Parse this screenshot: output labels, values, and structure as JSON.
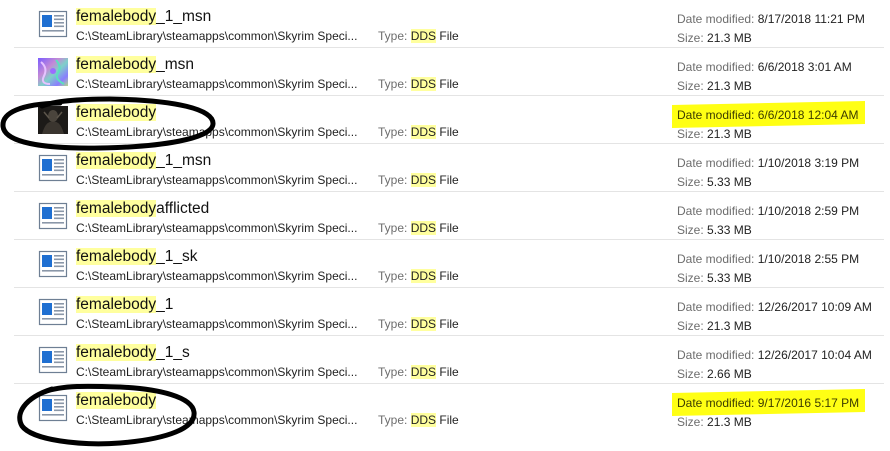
{
  "search_term": "femalebody",
  "labels": {
    "type": "Type:",
    "date_modified": "Date modified:",
    "size": "Size:"
  },
  "colors": {
    "search_highlight": "#ffff9e",
    "marker_highlight": "#ffff14",
    "annotation_ink": "#000000"
  },
  "results": [
    {
      "name_suffix": "_1_msn",
      "path": "C:\\SteamLibrary\\steamapps\\common\\Skyrim Speci...",
      "type_ext": "DDS",
      "type_rest": " File",
      "date": "8/17/2018 11:21 PM",
      "size": "21.3 MB",
      "icon": "document-icon"
    },
    {
      "name_suffix": "_msn",
      "path": "C:\\SteamLibrary\\steamapps\\common\\Skyrim Speci...",
      "type_ext": "DDS",
      "type_rest": " File",
      "date": "6/6/2018 3:01 AM",
      "size": "21.3 MB",
      "icon": "normal-map-thumbnail"
    },
    {
      "name_suffix": "",
      "path": "C:\\SteamLibrary\\steamapps\\common\\Skyrim Speci...",
      "type_ext": "DDS",
      "type_rest": " File",
      "date": "6/6/2018 12:04 AM",
      "size": "21.3 MB",
      "icon": "texture-thumbnail"
    },
    {
      "name_suffix": "_1_msn",
      "path": "C:\\SteamLibrary\\steamapps\\common\\Skyrim Speci...",
      "type_ext": "DDS",
      "type_rest": " File",
      "date": "1/10/2018 3:19 PM",
      "size": "5.33 MB",
      "icon": "document-icon"
    },
    {
      "name_suffix": "afflicted",
      "path": "C:\\SteamLibrary\\steamapps\\common\\Skyrim Speci...",
      "type_ext": "DDS",
      "type_rest": " File",
      "date": "1/10/2018 2:59 PM",
      "size": "5.33 MB",
      "icon": "document-icon"
    },
    {
      "name_suffix": "_1_sk",
      "path": "C:\\SteamLibrary\\steamapps\\common\\Skyrim Speci...",
      "type_ext": "DDS",
      "type_rest": " File",
      "date": "1/10/2018 2:55 PM",
      "size": "5.33 MB",
      "icon": "document-icon"
    },
    {
      "name_suffix": "_1",
      "path": "C:\\SteamLibrary\\steamapps\\common\\Skyrim Speci...",
      "type_ext": "DDS",
      "type_rest": " File",
      "date": "12/26/2017 10:09 AM",
      "size": "21.3 MB",
      "icon": "document-icon"
    },
    {
      "name_suffix": "_1_s",
      "path": "C:\\SteamLibrary\\steamapps\\common\\Skyrim Speci...",
      "type_ext": "DDS",
      "type_rest": " File",
      "date": "12/26/2017 10:04 AM",
      "size": "2.66 MB",
      "icon": "document-icon"
    },
    {
      "name_suffix": "",
      "path": "C:\\SteamLibrary\\steamapps\\common\\Skyrim Speci...",
      "type_ext": "DDS",
      "type_rest": " File",
      "date": "9/17/2016 5:17 PM",
      "size": "21.3 MB",
      "icon": "document-icon"
    }
  ],
  "annotations": {
    "yellow_marker_rows": [
      2,
      8
    ],
    "circled_rows": [
      2,
      8
    ]
  }
}
